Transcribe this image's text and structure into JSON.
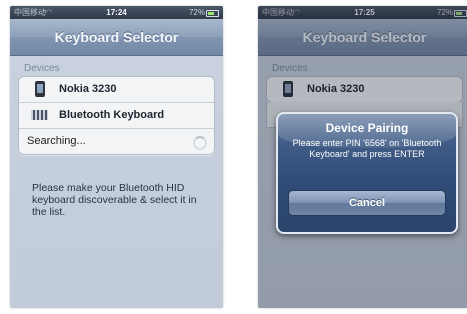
{
  "screens": [
    {
      "status": {
        "carrier": "中国移动",
        "time": "17:24",
        "battery": "72%"
      },
      "title": "Keyboard Selector",
      "devices_header": "Devices",
      "devices": [
        {
          "name": "Nokia 3230",
          "icon": "phone-icon"
        },
        {
          "name": "Bluetooth Keyboard",
          "icon": "keyboard-icon"
        }
      ],
      "searching_label": "Searching...",
      "info_text": "Please make your Bluetooth HID keyboard discoverable & select it in the list."
    },
    {
      "status": {
        "carrier": "中国移动",
        "time": "17:25",
        "battery": "72%"
      },
      "title": "Keyboard Selector",
      "devices_header": "Devices",
      "devices": [
        {
          "name": "Nokia 3230",
          "icon": "phone-icon"
        }
      ],
      "alert": {
        "title": "Device Pairing",
        "message": "Please enter PIN '6568' on 'Bluetooth Keyboard' and press ENTER",
        "cancel_label": "Cancel"
      }
    }
  ]
}
